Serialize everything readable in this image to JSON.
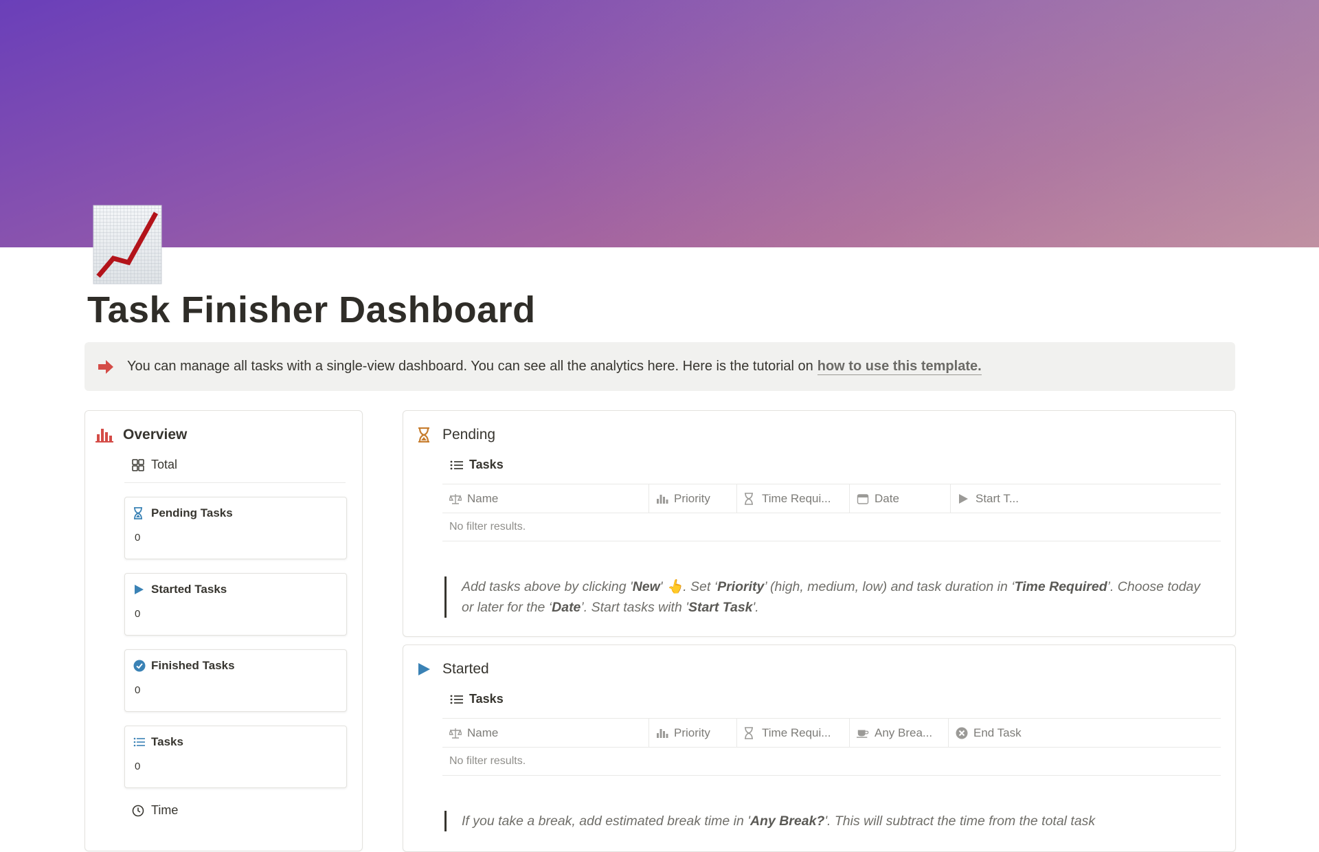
{
  "page": {
    "title": "Task Finisher Dashboard",
    "icon": "chart-increasing-icon"
  },
  "callout": {
    "icon": "right-arrow-icon",
    "text": "You can manage all tasks with a single-view dashboard. You can see all the analytics here. Here is the tutorial on",
    "link_text": "how to use this template."
  },
  "overview": {
    "heading": "Overview",
    "icon": "bar-chart-icon",
    "view_tab": "Total",
    "cards": [
      {
        "title": "Pending Tasks",
        "value": "0",
        "icon": "hourglass-icon"
      },
      {
        "title": "Started Tasks",
        "value": "0",
        "icon": "play-icon"
      },
      {
        "title": "Finished Tasks",
        "value": "0",
        "icon": "check-circle-icon"
      },
      {
        "title": "Tasks",
        "value": "0",
        "icon": "list-icon"
      }
    ],
    "time_tab": "Time"
  },
  "pending": {
    "heading": "Pending",
    "icon": "hourglass-icon",
    "view_tab": "Tasks",
    "columns": [
      "Name",
      "Priority",
      "Time Requi...",
      "Date",
      "Start T..."
    ],
    "empty_text": "No filter results.",
    "note": {
      "p1": "Add tasks above by clicking '",
      "b1": "New",
      "p2": "' 👆. Set ‘",
      "b2": "Priority",
      "p3": "’ (high, medium, low) and task duration in ‘",
      "b3": "Time Required",
      "p4": "’. Choose today or later for the ‘",
      "b4": "Date",
      "p5": "’. Start tasks with '",
      "b5": "Start Task",
      "p6": "'."
    }
  },
  "started": {
    "heading": "Started",
    "icon": "play-icon",
    "view_tab": "Tasks",
    "columns": [
      "Name",
      "Priority",
      "Time Requi...",
      "Any Brea...",
      "End Task"
    ],
    "empty_text": "No filter results.",
    "note": {
      "p1": "If you take a break, add estimated break time in '",
      "b1": "Any Break?",
      "p2": "'. This will subtract the time from the total task"
    }
  },
  "colors": {
    "accent_red": "#d44c47",
    "play_blue": "#3a82b5",
    "hourglass_orange": "#c77d2e"
  }
}
